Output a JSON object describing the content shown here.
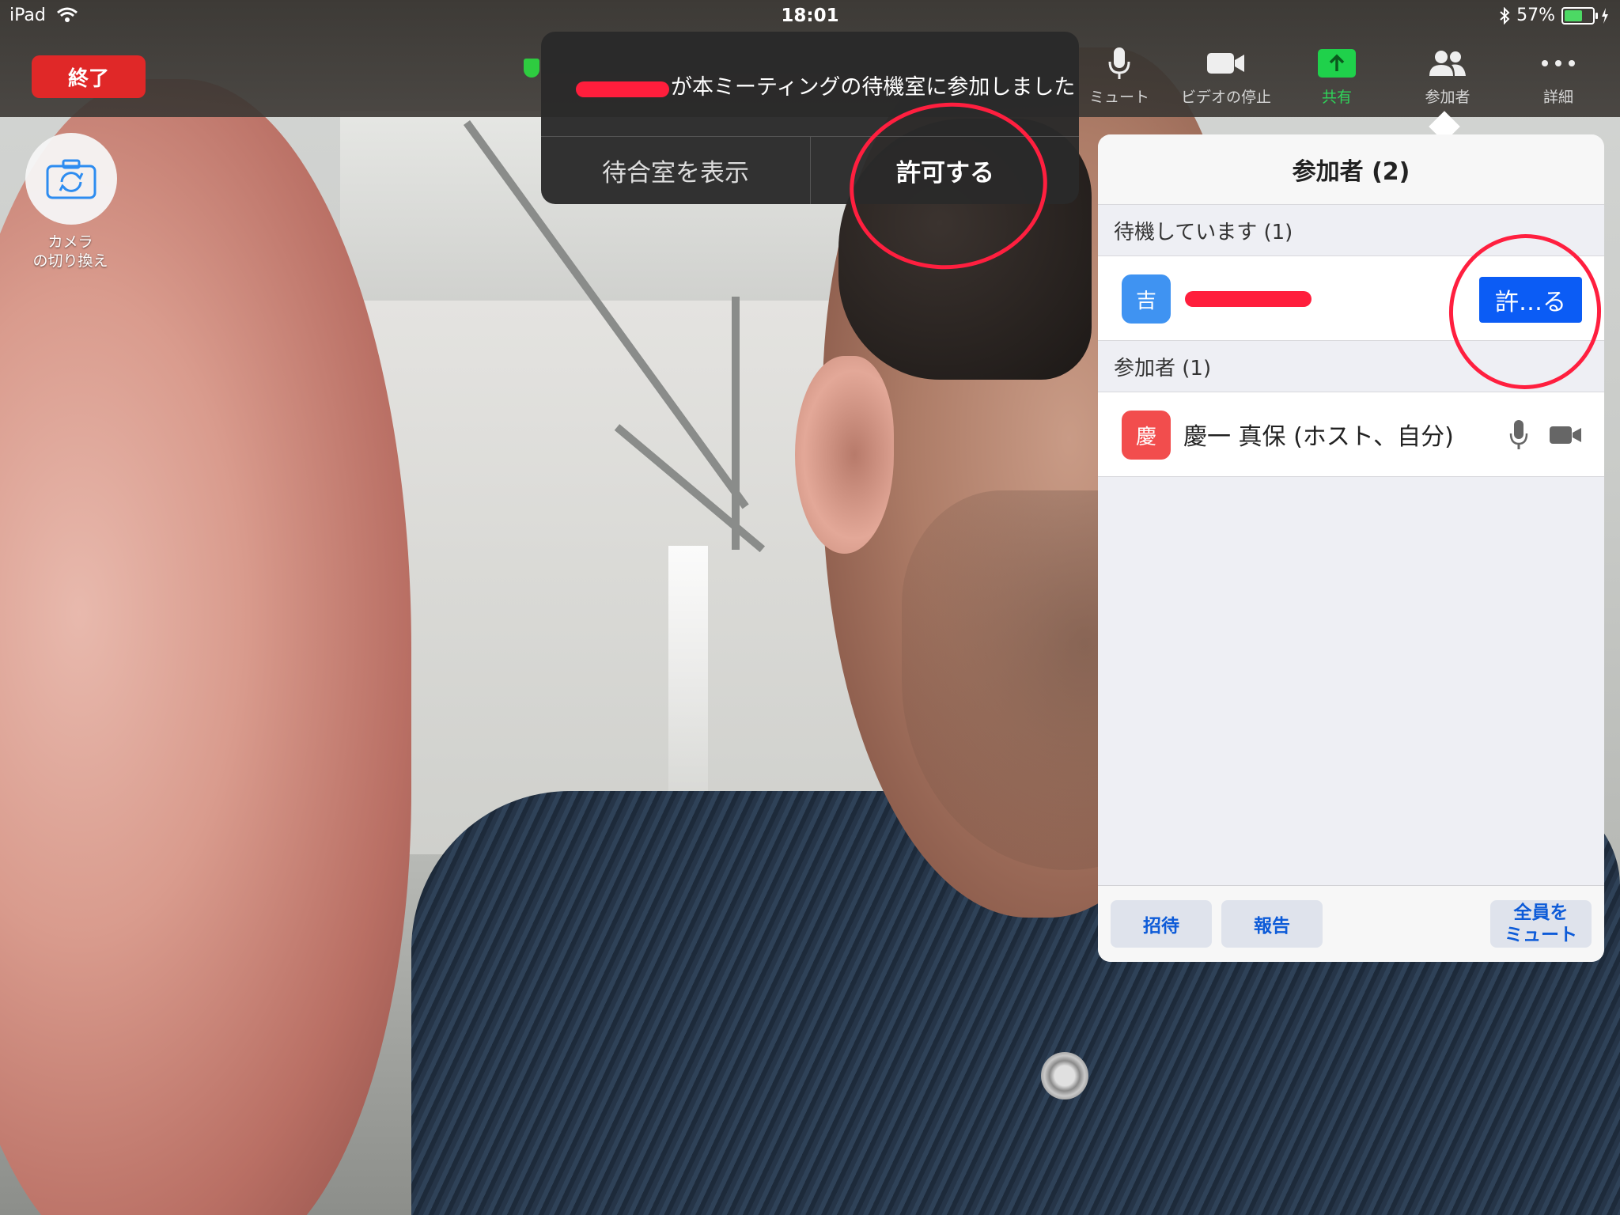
{
  "status_bar": {
    "device": "iPad",
    "time": "18:01",
    "battery": "57%"
  },
  "top_bar": {
    "end_button": "終了",
    "toolbar": [
      {
        "label": "ミュート",
        "icon": "microphone-icon"
      },
      {
        "label": "ビデオの停止",
        "icon": "video-camera-icon"
      },
      {
        "label": "共有",
        "icon": "share-upload-icon"
      },
      {
        "label": "参加者",
        "icon": "participants-icon"
      },
      {
        "label": "詳細",
        "icon": "more-dots-icon"
      }
    ]
  },
  "camera_switch": {
    "label_line1": "カメラ",
    "label_line2": "の切り換え"
  },
  "notification": {
    "message": "が本ミーティングの待機室に参加しました",
    "view_waiting_room": "待合室を表示",
    "admit": "許可する"
  },
  "participants_panel": {
    "title": "参加者 (2)",
    "waiting_section": "待機しています (1)",
    "waiting": [
      {
        "avatar_char": "吉",
        "admit_label": "許…る",
        "avatar_color": "#3f93f2"
      }
    ],
    "participants_section": "参加者 (1)",
    "participants": [
      {
        "avatar_char": "慶",
        "name": "慶一 真保 (ホスト、自分)",
        "avatar_color": "#f24d4d"
      }
    ],
    "footer": {
      "invite": "招待",
      "report": "報告",
      "mute_all_line1": "全員を",
      "mute_all_line2": "ミュート"
    }
  },
  "colors": {
    "end_red": "#e02828",
    "accent_blue": "#0b5cf5",
    "share_green": "#1fd14b",
    "annotation_red": "#ff1f3f"
  }
}
